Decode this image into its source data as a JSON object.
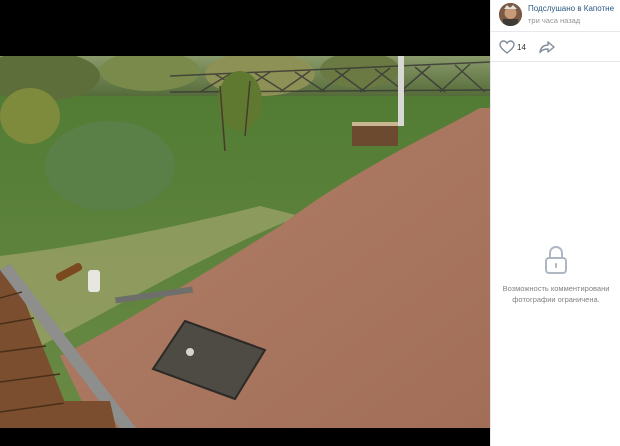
{
  "author": {
    "name": "Подслушано в Капотне",
    "time": "три часа назад"
  },
  "actions": {
    "likes": "14",
    "like_icon": "heart-icon",
    "share_icon": "share-arrow-icon"
  },
  "comments": {
    "locked_line1": "Возможность комментировани",
    "locked_line2": "фотографии ограничена.",
    "icon": "lock-icon"
  },
  "colors": {
    "link": "#2a5885",
    "muted": "#939393",
    "viewer_bg": "#000000"
  }
}
